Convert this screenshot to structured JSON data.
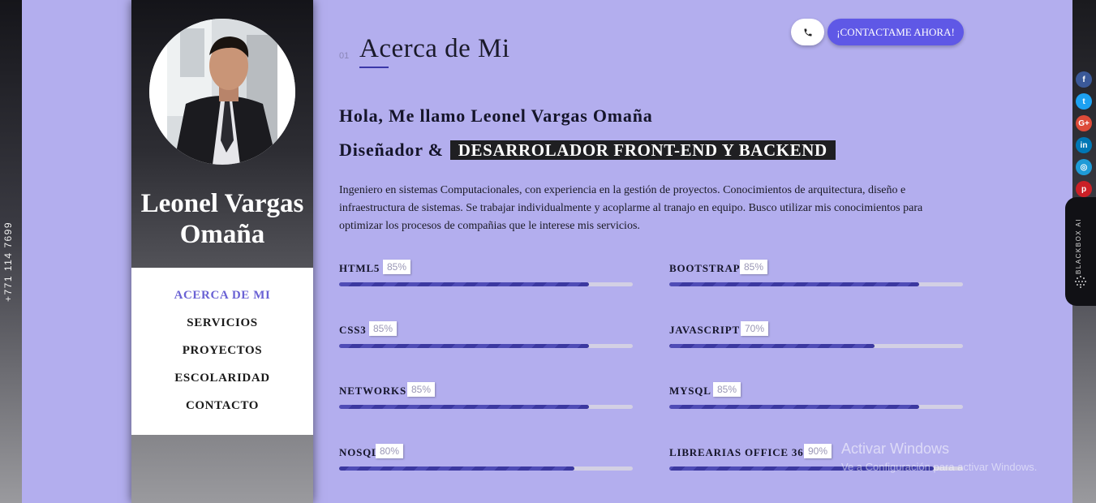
{
  "left_phone": "+771 114 7699",
  "profile": {
    "name": "Leonel Vargas Omaña"
  },
  "menu": [
    {
      "label": "ACERCA DE MI",
      "active": true
    },
    {
      "label": "SERVICIOS"
    },
    {
      "label": "PROYECTOS"
    },
    {
      "label": "ESCOLARIDAD"
    },
    {
      "label": "CONTACTO"
    }
  ],
  "section": {
    "number": "01",
    "title": "Acerca de Mi"
  },
  "header": {
    "phone_icon": "phone-icon",
    "contact_label": "¡CONTACTAME AHORA!"
  },
  "intro": {
    "hello": "Hola, Me llamo Leonel Vargas Omaña",
    "role_prefix": "Diseñador &",
    "role_tag": "DESARROLADOR FRONT-END Y BACKEND",
    "about": "Ingeniero en sistemas Computacionales, con experiencia en la gestión de proyectos. Conocimientos de arquitectura, diseño e infraestructura de sistemas. Se trabajar individualmente y acoplarme al tranajo en equipo. Busco utilizar mis conocimientos para optimizar los procesos de compañias que le interese mis servicios."
  },
  "skills": [
    {
      "name": "HTML5",
      "percent_label": "85%",
      "value": 85
    },
    {
      "name": "BOOTSTRAP",
      "percent_label": "85%",
      "value": 85
    },
    {
      "name": "CSS3",
      "percent_label": "85%",
      "value": 85
    },
    {
      "name": "JAVASCRIPT",
      "percent_label": "70%",
      "value": 70
    },
    {
      "name": "NETWORKS",
      "percent_label": "85%",
      "value": 85
    },
    {
      "name": "MYSQL",
      "percent_label": "85%",
      "value": 85
    },
    {
      "name": "NOSQL",
      "percent_label": "80%",
      "value": 80
    },
    {
      "name": "LIBREARIAS OFFICE 365",
      "percent_label": "90%",
      "value": 90
    }
  ],
  "social": [
    {
      "icon": "facebook-icon",
      "glyph": "f",
      "color": "#3b5998"
    },
    {
      "icon": "twitter-icon",
      "glyph": "t",
      "color": "#1da1f2"
    },
    {
      "icon": "google-plus-icon",
      "glyph": "G+",
      "color": "#dd4b39"
    },
    {
      "icon": "linkedin-icon",
      "glyph": "in",
      "color": "#0077b5"
    },
    {
      "icon": "instagram-icon",
      "glyph": "◎",
      "color": "#1f9bd7"
    },
    {
      "icon": "pinterest-icon",
      "glyph": "p",
      "color": "#cb2027"
    }
  ],
  "blackbox": "BLACKBOX AI",
  "watermark": {
    "line1": "Activar Windows",
    "line2": "Ve a Configuración para activar Windows."
  }
}
